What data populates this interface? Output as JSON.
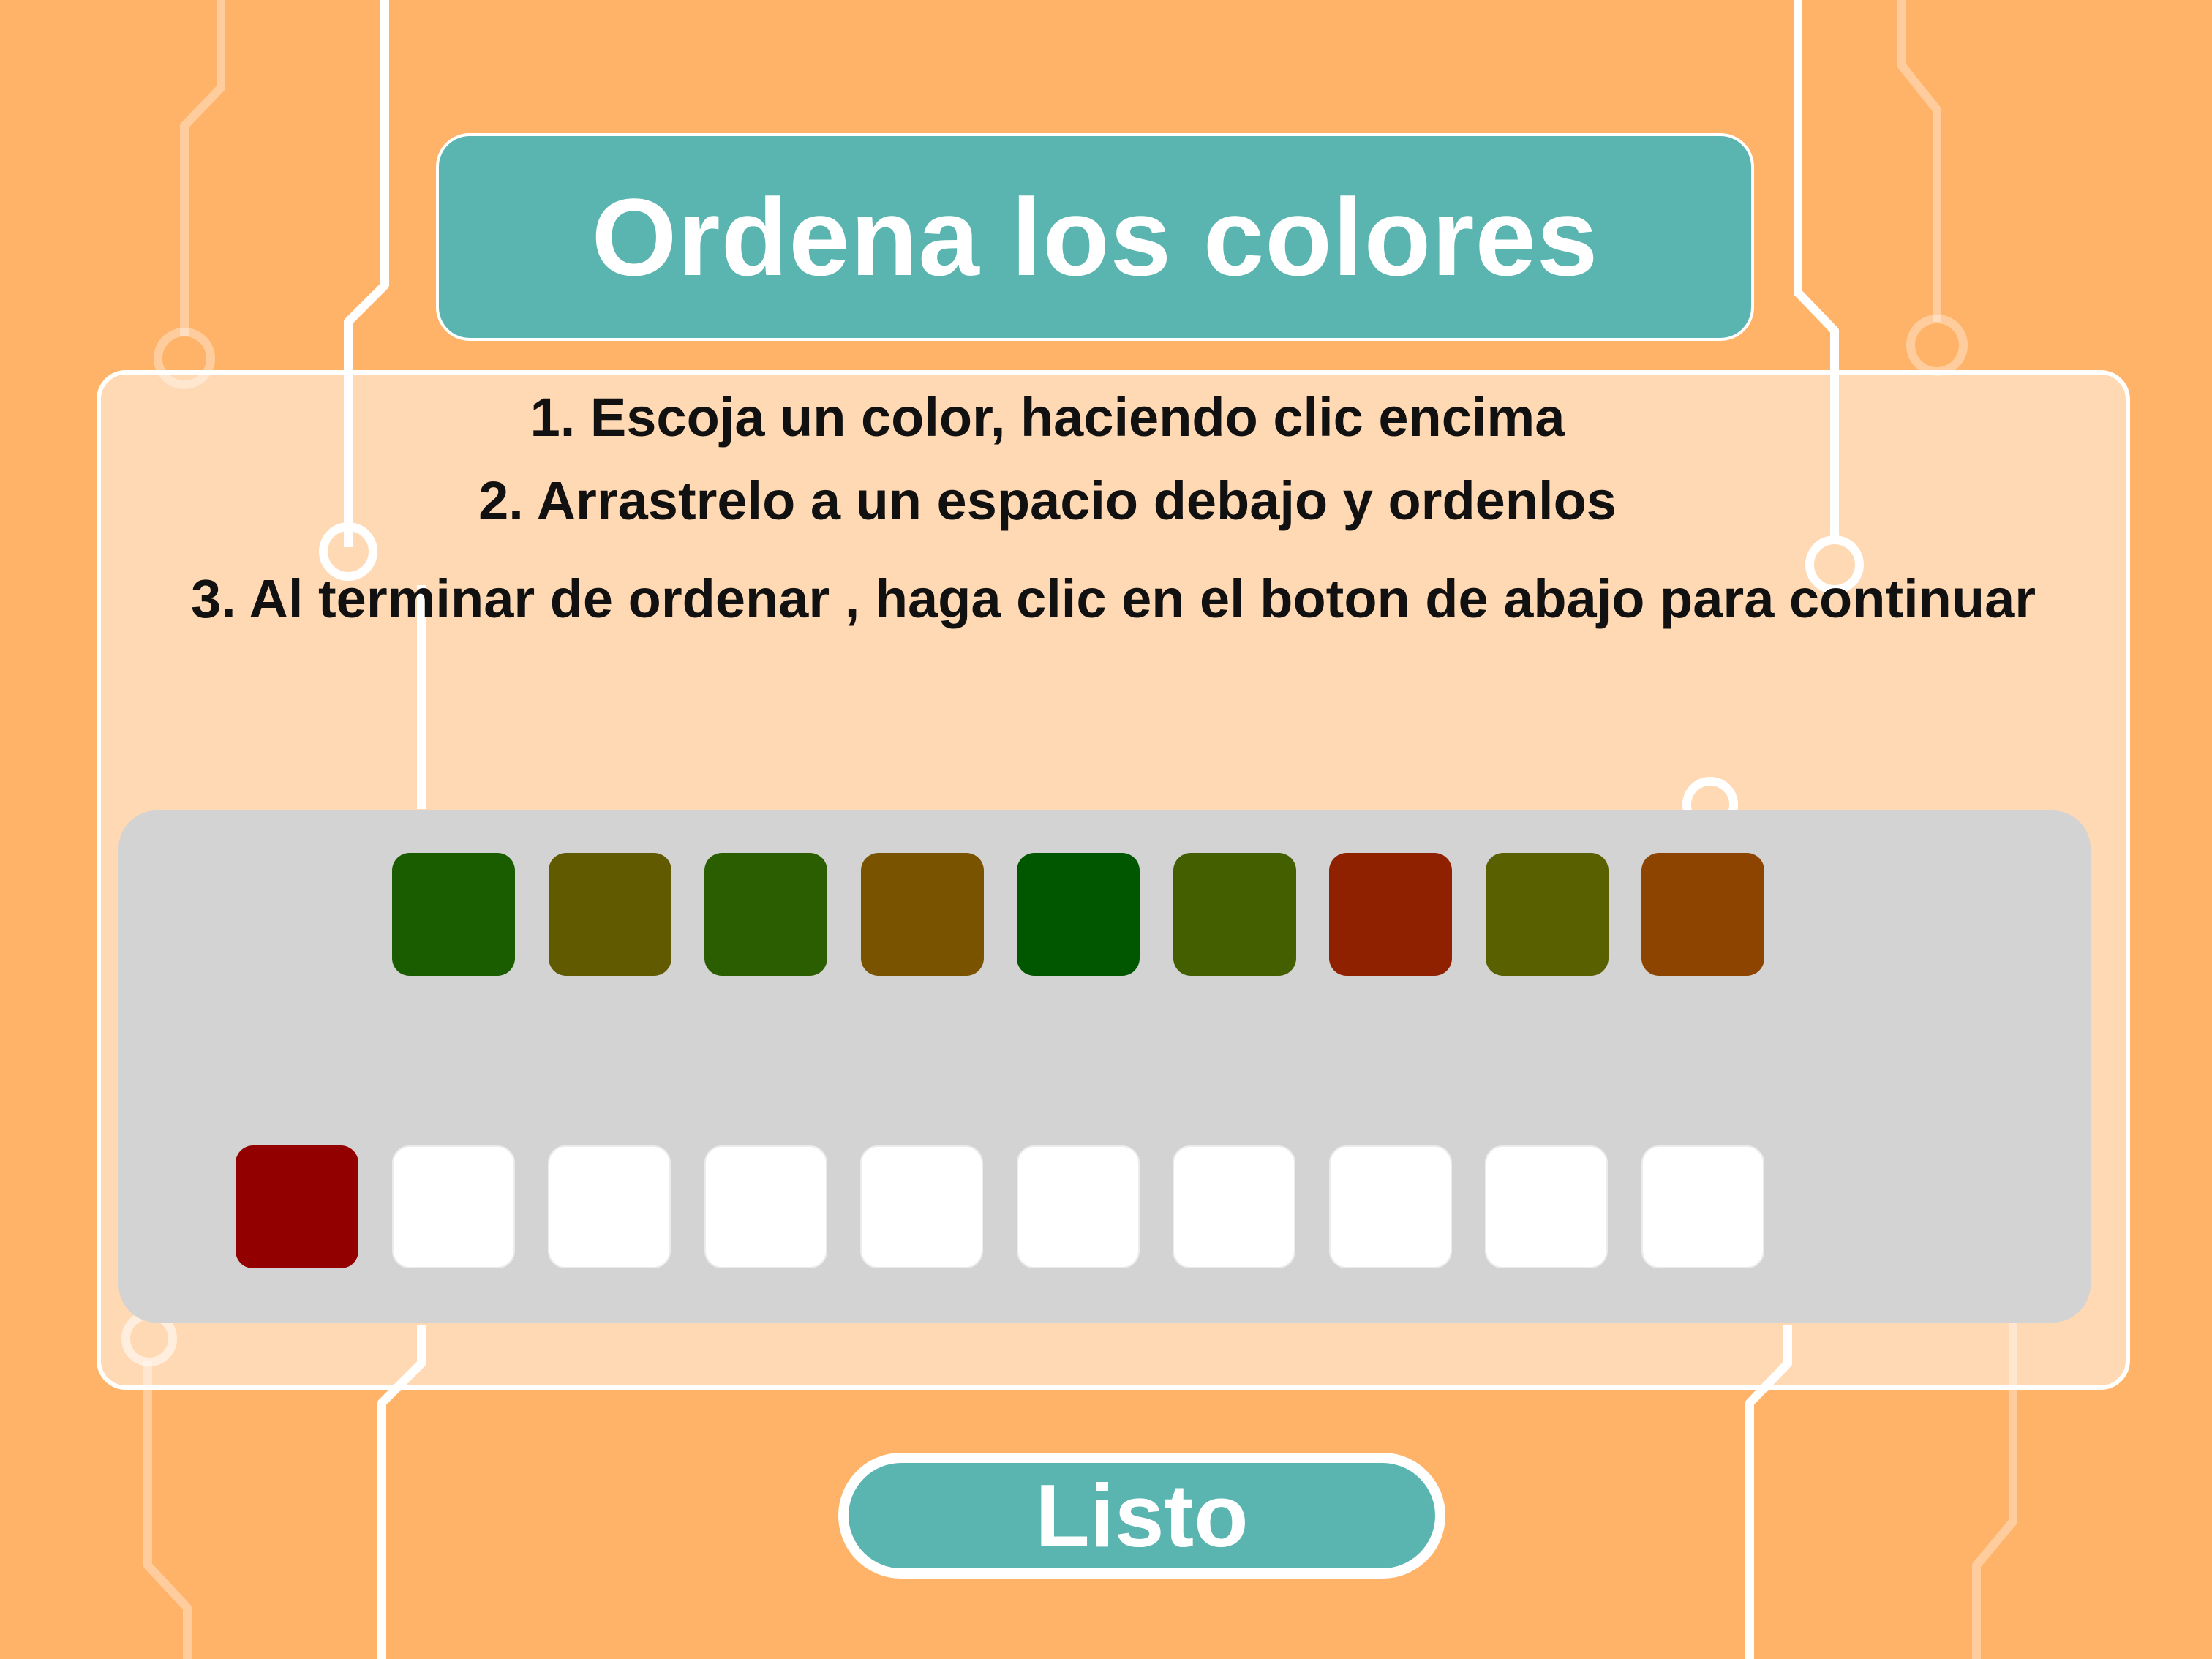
{
  "title": "Ordena los colores",
  "instructions": [
    "1. Escoja un color, haciendo clic encima",
    "2. Arrastrelo a un espacio debajo y ordenlos",
    "3. Al terminar de ordenar , haga clic en el boton de abajo para continuar"
  ],
  "palette": [
    "#1A5C00",
    "#625A00",
    "#2B5E00",
    "#7A5300",
    "#005700",
    "#445F00",
    "#8F2100",
    "#586000",
    "#8C4400"
  ],
  "answer_slots": [
    "#930000",
    null,
    null,
    null,
    null,
    null,
    null,
    null,
    null,
    null
  ],
  "button": {
    "label": "Listo"
  },
  "colors": {
    "background": "#FFB369",
    "accent": "#5AB5B0",
    "area": "#D3D3D3"
  }
}
